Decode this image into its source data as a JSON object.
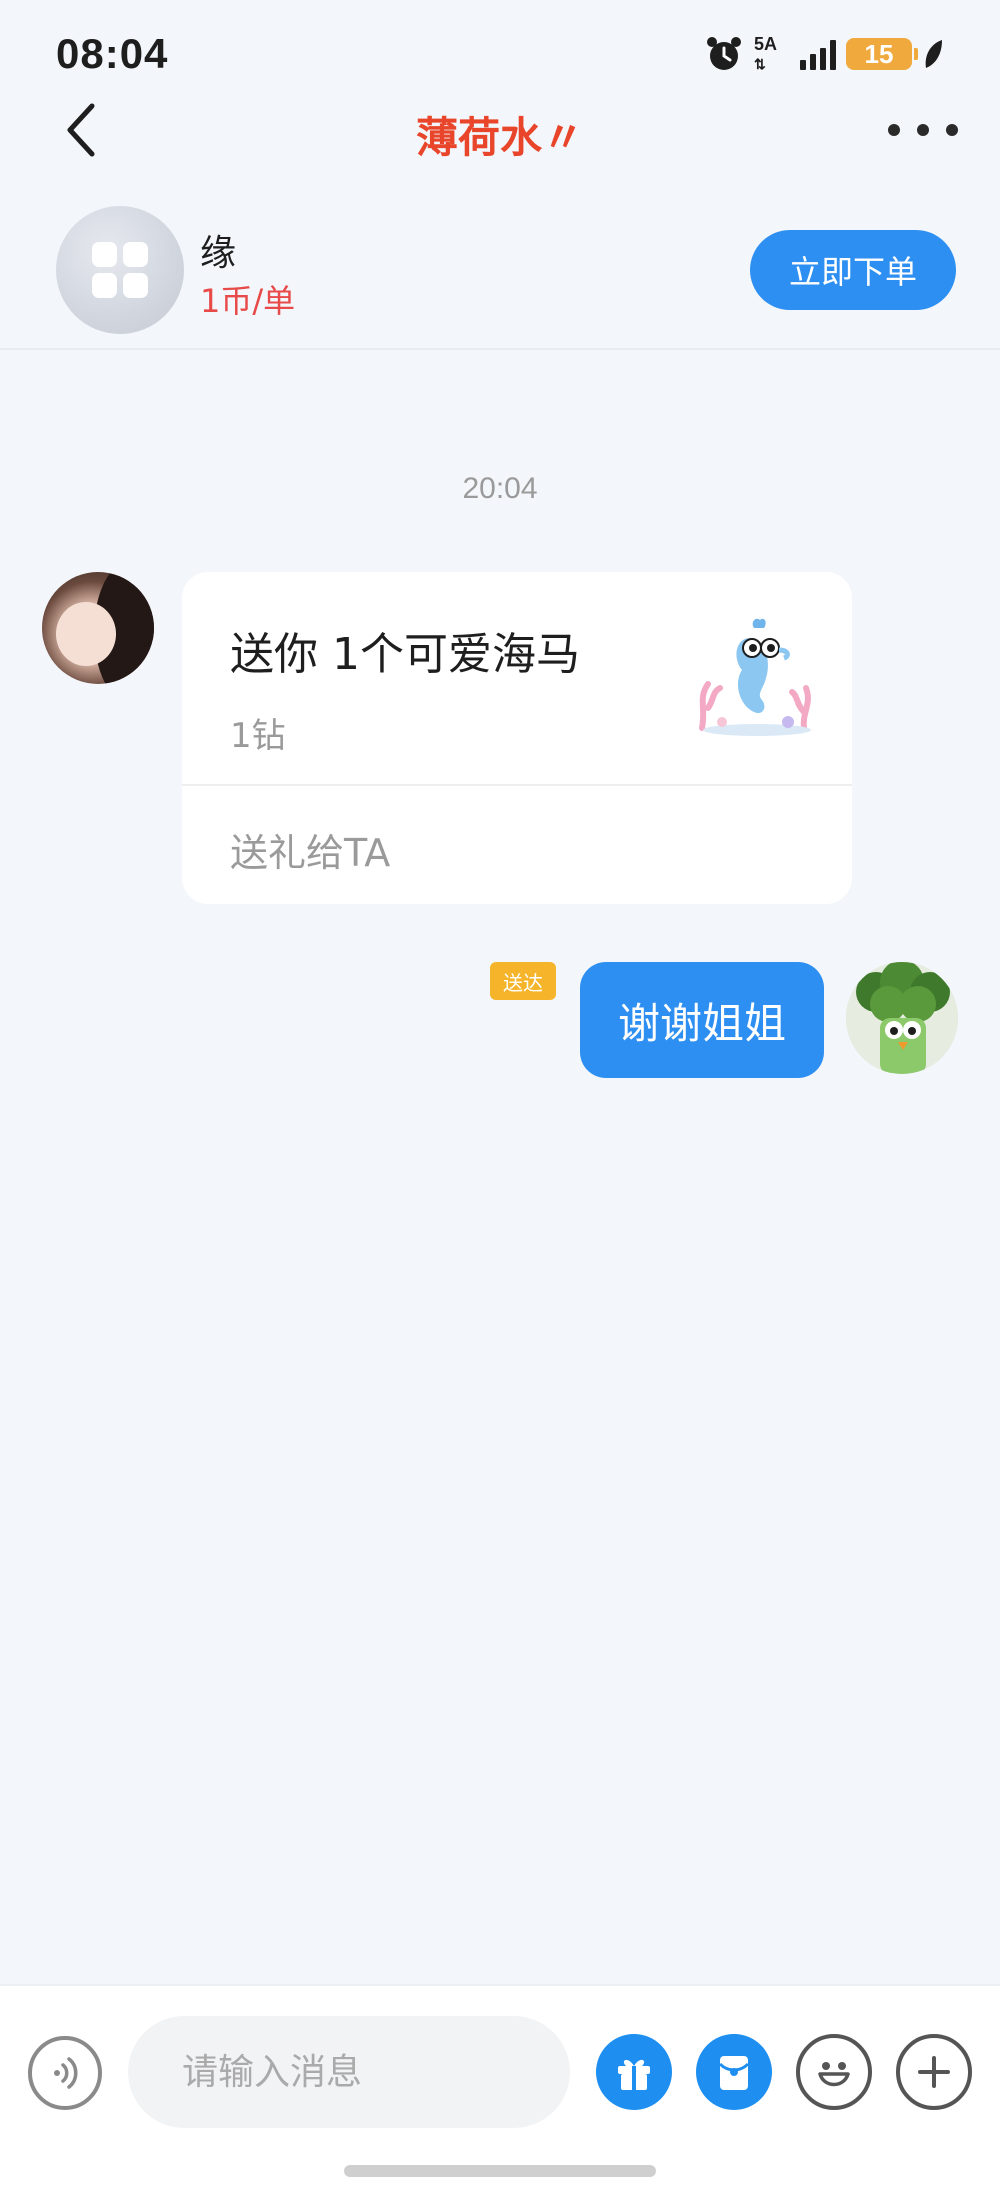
{
  "status_bar": {
    "time": "08:04",
    "network_label": "5A",
    "battery_level": "15",
    "icons": [
      "alarm-icon",
      "network-icon",
      "signal-icon",
      "battery-icon",
      "leaf-icon"
    ]
  },
  "nav": {
    "title": "薄荷水〃",
    "icons": [
      "back-arrow-icon",
      "more-dots-icon"
    ]
  },
  "service": {
    "name": "缘",
    "price": "1币/单",
    "order_label": "立即下单",
    "icon": "grid-icon"
  },
  "chat": {
    "timestamp": "20:04",
    "gift_message": {
      "title": "送你 1个可爱海马",
      "price": "1钻",
      "action": "送礼给TA",
      "image": "seahorse-gift-icon"
    },
    "my_message": {
      "status": "送达",
      "text": "谢谢姐姐"
    }
  },
  "input_bar": {
    "placeholder": "请输入消息",
    "icons": [
      "voice-icon",
      "gift-icon",
      "red-packet-icon",
      "emoji-icon",
      "plus-icon"
    ]
  },
  "colors": {
    "accent_blue": "#2e8ff2",
    "title_red": "#e8452b",
    "price_red": "#e84a4a",
    "badge_yellow": "#f6b42a",
    "background": "#f3f6fa"
  }
}
